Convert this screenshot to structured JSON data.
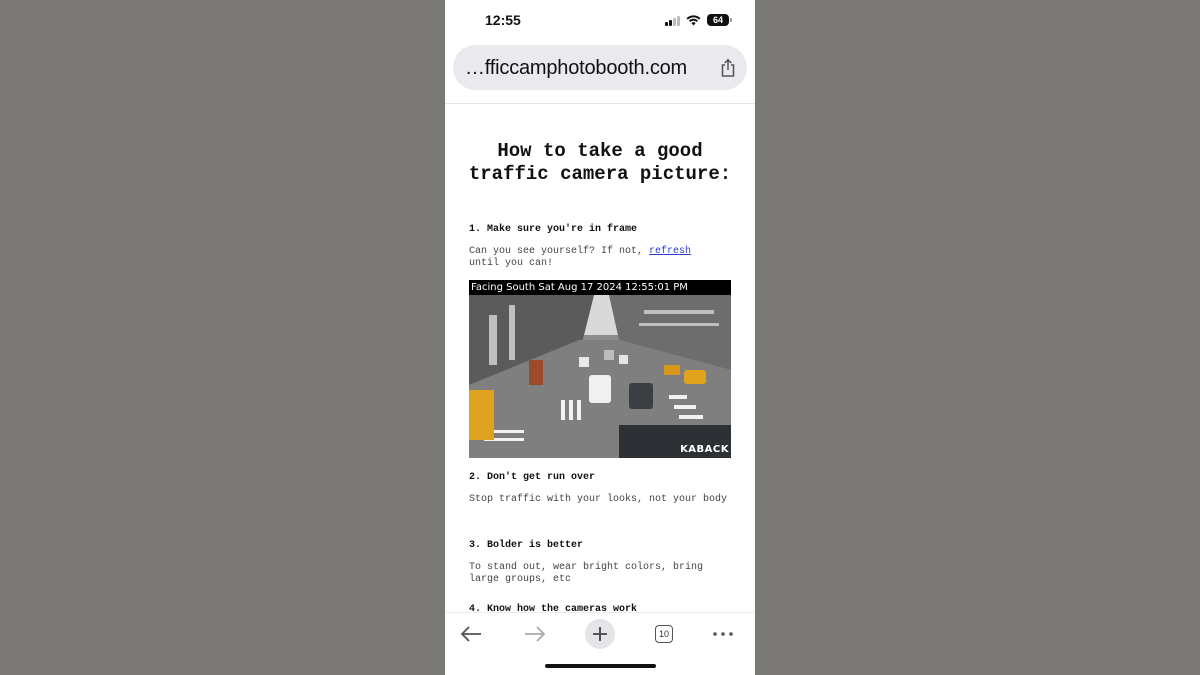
{
  "status_bar": {
    "time": "12:55",
    "battery": "64"
  },
  "browser": {
    "url": "…fficcamphotobooth.com",
    "tab_count": "10"
  },
  "page": {
    "title": "How to take a good traffic camera picture:",
    "steps": [
      {
        "heading": "1. Make sure you're in frame",
        "text_before": "Can you see yourself? If not, ",
        "link": "refresh",
        "text_after": " until you can!"
      },
      {
        "heading": "2. Don't get run over",
        "text": "Stop traffic with your looks, not your body"
      },
      {
        "heading": "3. Bolder is better",
        "text": "To stand out, wear bright colors, bring large groups, etc"
      }
    ],
    "cut_off_heading": "4. Know how the cameras work"
  },
  "camera": {
    "caption": "Facing South Sat Aug 17 2024 12:55:01 PM",
    "watermark": "KABACK"
  },
  "colors": {
    "link": "#2c3ad1",
    "background": "#797874"
  }
}
